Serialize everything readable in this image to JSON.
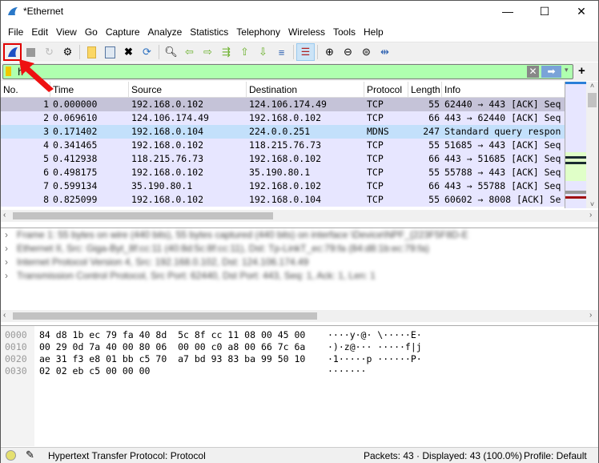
{
  "window": {
    "title": "*Ethernet",
    "minimize": "—",
    "maximize": "☐",
    "close": "✕"
  },
  "menu": [
    "File",
    "Edit",
    "View",
    "Go",
    "Capture",
    "Analyze",
    "Statistics",
    "Telephony",
    "Wireless",
    "Tools",
    "Help"
  ],
  "toolbar": {
    "icons": [
      "start-capture",
      "stop-capture",
      "restart-capture",
      "capture-options",
      "open-file",
      "save-file",
      "close-file",
      "reload-file",
      "find-packet",
      "go-back",
      "go-forward",
      "go-to-packet",
      "go-first",
      "go-last",
      "auto-scroll",
      "colorize",
      "zoom-in",
      "zoom-out",
      "zoom-normal",
      "resize-columns"
    ],
    "highlighted": "start-capture"
  },
  "filter": {
    "value": "h",
    "clear": "✕",
    "apply": "➡",
    "dropdown": "▾",
    "add": "+"
  },
  "packet_list": {
    "columns": [
      "No.",
      "Time",
      "Source",
      "Destination",
      "Protocol",
      "Length",
      "Info"
    ],
    "rows": [
      [
        "1",
        "0.000000",
        "192.168.0.102",
        "124.106.174.49",
        "TCP",
        "55",
        "62440 → 443 [ACK] Seq"
      ],
      [
        "2",
        "0.069610",
        "124.106.174.49",
        "192.168.0.102",
        "TCP",
        "66",
        "443 → 62440 [ACK] Seq"
      ],
      [
        "3",
        "0.171402",
        "192.168.0.104",
        "224.0.0.251",
        "MDNS",
        "247",
        "Standard query respon"
      ],
      [
        "4",
        "0.341465",
        "192.168.0.102",
        "118.215.76.73",
        "TCP",
        "55",
        "51685 → 443 [ACK] Seq"
      ],
      [
        "5",
        "0.412938",
        "118.215.76.73",
        "192.168.0.102",
        "TCP",
        "66",
        "443 → 51685 [ACK] Seq"
      ],
      [
        "6",
        "0.498175",
        "192.168.0.102",
        "35.190.80.1",
        "TCP",
        "55",
        "55788 → 443 [ACK] Seq"
      ],
      [
        "7",
        "0.599134",
        "35.190.80.1",
        "192.168.0.102",
        "TCP",
        "66",
        "443 → 55788 [ACK] Seq"
      ],
      [
        "8",
        "0.825099",
        "192.168.0.102",
        "192.168.0.104",
        "TCP",
        "55",
        "60602 → 8008 [ACK] Se"
      ]
    ]
  },
  "details": [
    "Frame 1: 55 bytes on wire (440 bits), 55 bytes captured (440 bits) on interface \\Device\\NPF_{223F5F8D-E",
    "Ethernet II, Src: Giga-Byt_8f:cc:11 (40:8d:5c:8f:cc:11), Dst: Tp-LinkT_ec:79:fa (84:d8:1b:ec:79:fa)",
    "Internet Protocol Version 4, Src: 192.168.0.102, Dst: 124.106.174.49",
    "Transmission Control Protocol, Src Port: 62440, Dst Port: 443, Seq: 1, Ack: 1, Len: 1"
  ],
  "hex": [
    {
      "offset": "0000",
      "bytes": "84 d8 1b ec 79 fa 40 8d  5c 8f cc 11 08 00 45 00",
      "ascii": "····y·@· \\·····E·"
    },
    {
      "offset": "0010",
      "bytes": "00 29 0d 7a 40 00 80 06  00 00 c0 a8 00 66 7c 6a",
      "ascii": "·)·z@··· ·····f|j"
    },
    {
      "offset": "0020",
      "bytes": "ae 31 f3 e8 01 bb c5 70  a7 bd 93 83 ba 99 50 10",
      "ascii": "·1·····p ······P·"
    },
    {
      "offset": "0030",
      "bytes": "02 02 eb c5 00 00 00",
      "ascii": "·······"
    }
  ],
  "status": {
    "field": "Hypertext Transfer Protocol: Protocol",
    "packets": "Packets: 43 · Displayed: 43 (100.0%)",
    "profile": "Profile: Default"
  },
  "colors": {
    "tcp_row": "#e7e6ff",
    "selected_row": "#c5c3d8",
    "mdns_row": "#c3e0fb",
    "filter_valid": "#afffaf",
    "highlight": "#ff0000"
  }
}
